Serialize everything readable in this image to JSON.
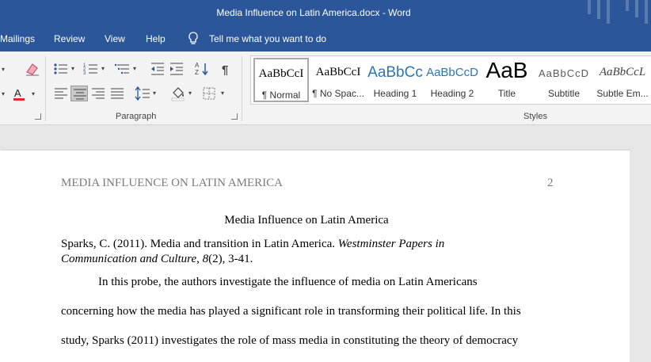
{
  "window": {
    "title": "Media Influence on Latin America.docx  -  Word"
  },
  "menu": {
    "tabs": [
      "Mailings",
      "Review",
      "View",
      "Help"
    ],
    "tell_me": "Tell me what you want to do"
  },
  "ribbon": {
    "groups": {
      "paragraph": "Paragraph",
      "styles": "Styles"
    },
    "styles": [
      {
        "preview": "AaBbCcI",
        "name": "¶ Normal"
      },
      {
        "preview": "AaBbCcI",
        "name": "¶ No Spac..."
      },
      {
        "preview": "AaBbCc",
        "name": "Heading 1"
      },
      {
        "preview": "AaBbCcD",
        "name": "Heading 2"
      },
      {
        "preview": "AaB",
        "name": "Title"
      },
      {
        "preview": "AaBbCcD",
        "name": "Subtitle"
      },
      {
        "preview": "AaBbCcL",
        "name": "Subtle Em..."
      }
    ],
    "colors": {
      "font_color": "#e8262b",
      "heading_blue": "#2e74b5"
    }
  },
  "document": {
    "header_title": "MEDIA INFLUENCE ON LATIN AMERICA",
    "page_number": "2",
    "title": "Media Influence on Latin America",
    "citation": {
      "part1": "Sparks, C. (2011). Media and transition in Latin America. ",
      "journal1": "Westminster Papers in",
      "journal2": "Communication and Culture",
      "sep": ", ",
      "volume": "8",
      "rest": "(2), 3-41."
    },
    "body_lines": [
      "In this probe, the authors investigate the influence of media on Latin Americans",
      "concerning how the media has played a significant role in transforming their political life. In this",
      "study, Sparks (2011) investigates the role of mass media in constituting the theory of democracy"
    ]
  }
}
